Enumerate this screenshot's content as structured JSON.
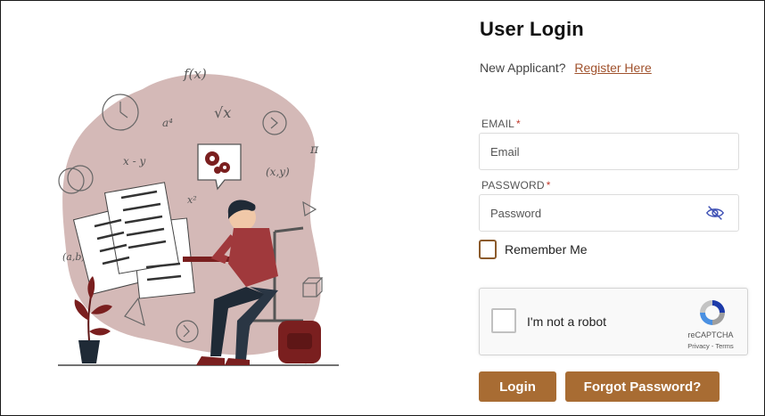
{
  "login": {
    "title": "User Login",
    "applicant_text": "New Applicant?",
    "register_link": "Register Here",
    "email_label": "EMAIL",
    "email_placeholder": "Email",
    "password_label": "PASSWORD",
    "password_placeholder": "Password",
    "required_mark": "*",
    "remember_label": "Remember Me",
    "login_button": "Login",
    "forgot_button": "Forgot Password?"
  },
  "recaptcha": {
    "label": "I'm not a robot",
    "brand": "reCAPTCHA",
    "links": "Privacy - Terms"
  },
  "illustration": {
    "math_symbols": [
      "f(x)",
      "√x",
      "a⁴",
      "x - y",
      "x²",
      "(x,y)",
      "π",
      "(a,b)"
    ]
  },
  "colors": {
    "accent": "#a86c33",
    "link": "#a0522d",
    "blob": "#d4b9b7",
    "dark_red": "#7a1f1f",
    "navy": "#1f2a36"
  },
  "icons": {
    "password_toggle": "eye-slash-icon",
    "captcha_logo": "recaptcha-icon",
    "gears": "gear-icon"
  }
}
